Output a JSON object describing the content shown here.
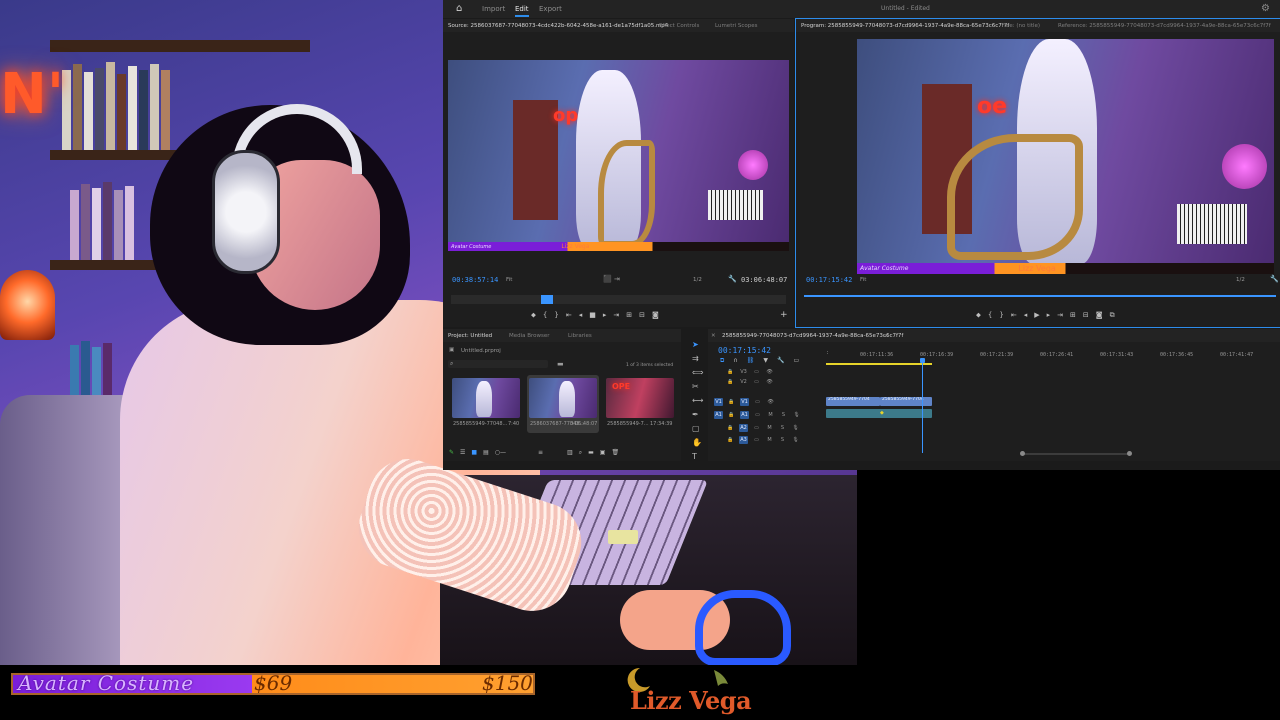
{
  "app": {
    "workspaces": [
      "Import",
      "Edit",
      "Export"
    ],
    "active_workspace": "Edit",
    "project_title": "Untitled - Edited"
  },
  "source_monitor": {
    "tabs": [
      "Source: 2586037687-77048073-4cdc422b-6042-458e-a161-de1a75df1a05.mp4",
      "Effect Controls",
      "Lumetri Scopes"
    ],
    "timecode_in": "00:38:57:14",
    "fit": "Fit",
    "ratio": "1/2",
    "duration": "03:06:48:07"
  },
  "program_monitor": {
    "tabs": [
      "Program: 2585855949-77048073-d7cd9964-1937-4a9e-88ca-65e73c6c7f7f",
      "Title: (no title)",
      "Reference: 2585855949-77048073-d7cd9964-1937-4a9e-88ca-65e73c6c7f7f"
    ],
    "timecode": "00:17:15:42",
    "fit": "Fit",
    "ratio": "1/2"
  },
  "monitor_overlay": {
    "goal_name": "Avatar Costume",
    "streamer": "Lizz Vega"
  },
  "project_panel": {
    "tabs": [
      "Project: Untitled",
      "Media Browser",
      "Libraries"
    ],
    "file": "Untitled.prproj",
    "selection_info": "1 of 3 items selected",
    "items": [
      {
        "name": "2585855949-77048...",
        "duration": "7:40"
      },
      {
        "name": "2586037687-77048...",
        "duration": "3:06:48:07"
      },
      {
        "name": "2585855949-7...",
        "duration": "17:34:39"
      }
    ]
  },
  "timeline": {
    "sequence_tab": "2585855949-77048073-d7cd9964-1937-4a9e-88ca-65e73c6c7f7f",
    "timecode": "00:17:15:42",
    "ruler": [
      "00:17:11:36",
      "00:17:16:39",
      "00:17:21:39",
      "00:17:26:41",
      "00:17:31:43",
      "00:17:36:45",
      "00:17:41:47"
    ],
    "video_tracks": [
      "V3",
      "V2",
      "V1"
    ],
    "audio_tracks": [
      "A1",
      "A2",
      "A3"
    ],
    "clip_labels": [
      "2585855949-7704",
      "2585855949-7704"
    ]
  },
  "stream_overlay": {
    "goal_name": "Avatar Costume",
    "current": "$69",
    "target": "$150",
    "progress": 0.46,
    "streamer": "Lizz Vega"
  },
  "colors": {
    "accent_blue": "#2d8ceb",
    "goal_purple": "#8a2ae6",
    "goal_orange": "#ff9422",
    "logo_orange": "#e05a2a"
  }
}
